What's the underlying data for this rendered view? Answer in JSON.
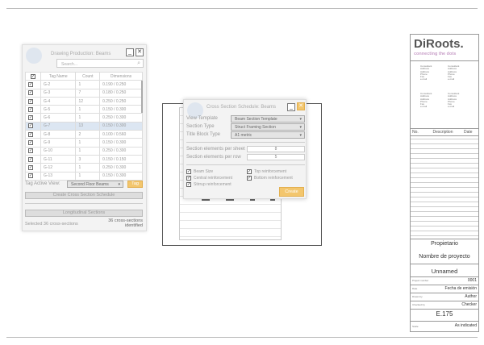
{
  "left_panel": {
    "title": "Drawing Production: Beams",
    "minimize": "_",
    "close": "✕",
    "search_placeholder": "Search...",
    "columns": [
      "Tag Name",
      "Count",
      "Dimensions"
    ],
    "rows": [
      [
        "G-2",
        "1",
        "0.190 / 0.250"
      ],
      [
        "G-3",
        "7",
        "0.180 / 0.250"
      ],
      [
        "G-4",
        "12",
        "0.250 / 0.250"
      ],
      [
        "G-5",
        "1",
        "0.150 / 0.300"
      ],
      [
        "G-6",
        "1",
        "0.250 / 0.300"
      ],
      [
        "G-7",
        "13",
        "0.150 / 0.300"
      ],
      [
        "G-8",
        "2",
        "0.100 / 0.560"
      ],
      [
        "G-9",
        "1",
        "0.150 / 0.300"
      ],
      [
        "G-10",
        "1",
        "0.250 / 0.300"
      ],
      [
        "G-11",
        "3",
        "0.150 / 0.150"
      ],
      [
        "G-12",
        "1",
        "0.250 / 0.300"
      ],
      [
        "G-13",
        "1",
        "0.150 / 0.300"
      ]
    ],
    "selected_row": "G-7",
    "tag_active_view_label": "Tag Active View:",
    "tag_active_view_value": "Second Floor Beams",
    "tag_button": "Tag",
    "create_schedule": "Create Cross Section Schedule",
    "longitudinal": "Longitudinal Sections",
    "status_selected": "Selected 36 cross-sections",
    "status_identified": "36 cross-sections identified"
  },
  "dialog": {
    "title": "Cross Section Schedule: Beams",
    "minimize": "_",
    "close": "✕",
    "view_template_label": "View Template",
    "view_template": "Beam Section Template",
    "section_type_label": "Section Type",
    "section_type": "Struct Framing Section",
    "title_block_label": "Title Block Type",
    "title_block": "A1 metric",
    "per_sheet_label": "Section elements per sheet",
    "per_sheet": "8",
    "per_row_label": "Section elements per row",
    "per_row": "5",
    "checks": [
      "Beam Size",
      "Central reinforcement",
      "Stirrup reinforcement",
      "Top reinforcement",
      "Bottom reinforcement"
    ],
    "create": "Create"
  },
  "title_block": {
    "logo": "DiRoots.",
    "tagline": "connecting the dots",
    "consultant": [
      "Consultant",
      "Address",
      "Address",
      "Phone",
      "Fax",
      "e-mail"
    ],
    "rev_cols": [
      "No.",
      "Description",
      "Date"
    ],
    "owner": "Propietario",
    "project": "Nombre de proyecto",
    "sheet_name": "Unnamed",
    "fields": [
      [
        "Project number",
        "0001"
      ],
      [
        "Date",
        "Fecha de emisión"
      ],
      [
        "Drawn by",
        "Author"
      ],
      [
        "Checked by",
        "Checker"
      ]
    ],
    "sheet_number": "E.175",
    "scale_label": "Scale",
    "scale": "As indicated"
  },
  "colors": {
    "accent": "#f3c66d",
    "selected_row": "#dce6f2"
  }
}
